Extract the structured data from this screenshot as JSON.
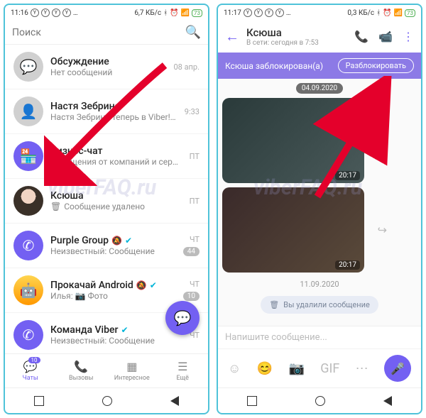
{
  "left": {
    "status": {
      "time": "11:16",
      "net": "6,7 КБ/с",
      "battery": "73"
    },
    "search_placeholder": "Поиск",
    "chats": [
      {
        "title": "Обсуждение",
        "sub": "Нет сообщений",
        "time": "08 апр."
      },
      {
        "title": "Настя Зебрина",
        "sub": "Настя Зебрина теперь в Viber! Скажите \"привет\" стикером!",
        "time": "9:33"
      },
      {
        "title": "Бизнес-чат",
        "sub": "Сообщения от компаний и сервисов",
        "time": "ПТ"
      },
      {
        "title": "Ксюша",
        "sub": "Сообщение удалено",
        "time": "ПТ"
      },
      {
        "title": "Purple Group",
        "sub": "Неизвестный: Сообщение",
        "time": "ЧТ",
        "badge": "44",
        "muted": true,
        "verified": true
      },
      {
        "title": "Прокачай Android",
        "sub": "Илья: 📷 Фото",
        "time": "ЧТ",
        "badge": "10",
        "muted": true,
        "verified": true
      },
      {
        "title": "Команда Viber",
        "sub": "Неизвестный: Сообщение",
        "time": "ЧТ",
        "verified": true
      }
    ],
    "tabs": {
      "chats": "Чаты",
      "calls": "Вызовы",
      "news": "Интересное",
      "more": "Ещё",
      "chats_badge": "10"
    }
  },
  "right": {
    "status": {
      "time": "11:17",
      "net": "0,3 КБ/с",
      "battery": "73"
    },
    "header": {
      "name": "Ксюша",
      "status": "В сети: сегодня в 7:53"
    },
    "banner": {
      "text": "Ксюша заблокирован(а)",
      "button": "Разблокировать"
    },
    "dates": {
      "d1": "04.09.2020",
      "d2": "11.09.2020"
    },
    "media_time": "20:17",
    "deleted": "Вы удалили сообщение",
    "input_placeholder": "Напишите сообщение..."
  },
  "watermark": "viberFAQ.ru"
}
